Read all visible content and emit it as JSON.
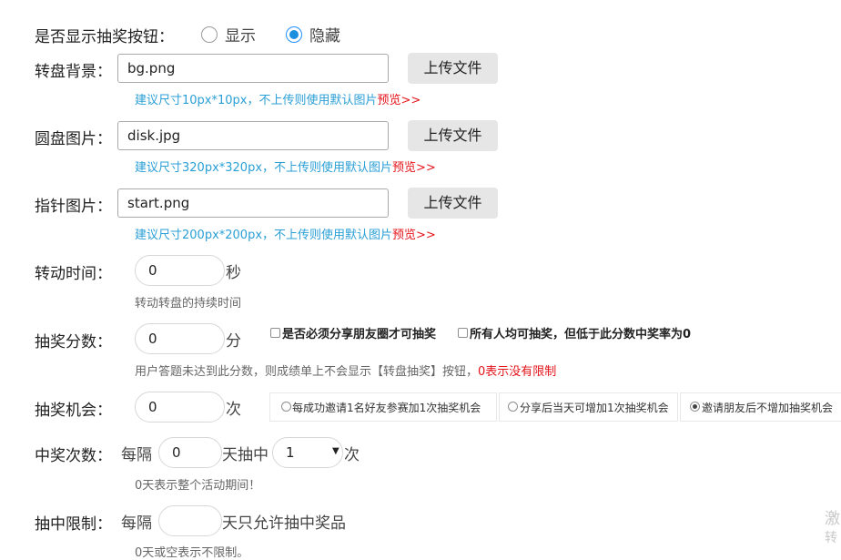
{
  "show_button": {
    "label": "是否显示抽奖按钮：",
    "options": [
      "显示",
      "隐藏"
    ],
    "selected": "隐藏"
  },
  "images": [
    {
      "label": "转盘背景：",
      "value": "bg.png",
      "button": "上传文件",
      "hint": "建议尺寸10px*10px，不上传则使用默认图片",
      "preview": "预览>>"
    },
    {
      "label": "圆盘图片：",
      "value": "disk.jpg",
      "button": "上传文件",
      "hint": "建议尺寸320px*320px，不上传则使用默认图片",
      "preview": "预览>>"
    },
    {
      "label": "指针图片：",
      "value": "start.png",
      "button": "上传文件",
      "hint": "建议尺寸200px*200px，不上传则使用默认图片",
      "preview": "预览>>"
    }
  ],
  "rotate_time": {
    "label": "转动时间：",
    "value": "0",
    "unit": "秒",
    "hint": "转动转盘的持续时间"
  },
  "score": {
    "label": "抽奖分数：",
    "value": "0",
    "unit": "分",
    "check1": "是否必须分享朋友圈才可抽奖",
    "check2": "所有人均可抽奖，但低于此分数中奖率为0",
    "hint_gray": "用户答题未达到此分数，则成绩单上不会显示【转盘抽奖】按钮，",
    "hint_red": "0表示没有限制"
  },
  "chances": {
    "label": "抽奖机会：",
    "value": "0",
    "unit": "次",
    "options": [
      "每成功邀请1名好友参赛加1次抽奖机会",
      "分享后当天可增加1次抽奖机会",
      "邀请朋友后不增加抽奖机会"
    ],
    "selected": "邀请朋友后不增加抽奖机会"
  },
  "win_count": {
    "label": "中奖次数：",
    "prefix": "每隔",
    "days": "0",
    "middle": "天抽中",
    "count": "1",
    "unit": "次",
    "hint": "0天表示整个活动期间！"
  },
  "win_limit": {
    "label": "抽中限制：",
    "prefix": "每隔",
    "days": "",
    "suffix": "天只允许抽中奖品",
    "hint": "0天或空表示不限制。"
  },
  "watermark": {
    "line1": "激",
    "line2": "转"
  }
}
